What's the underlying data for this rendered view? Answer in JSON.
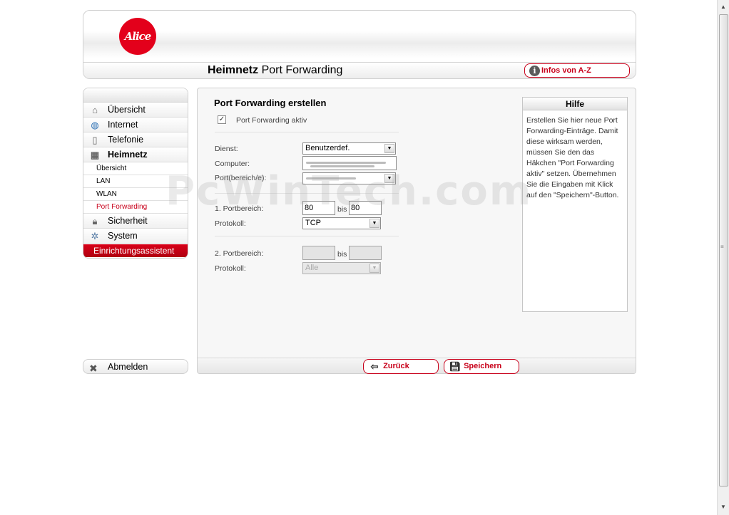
{
  "brand": {
    "logo_text": "Alice",
    "accent": "#e3001b"
  },
  "header": {
    "title_bold": "Heimnetz",
    "title_rest": " Port Forwarding",
    "infos_label": "Infos von A-Z"
  },
  "sidebar": {
    "items": [
      {
        "label": "Übersicht",
        "icon": "house-icon"
      },
      {
        "label": "Internet",
        "icon": "globe-icon"
      },
      {
        "label": "Telefonie",
        "icon": "phone-icon"
      },
      {
        "label": "Heimnetz",
        "icon": "network-icon"
      }
    ],
    "subitems": [
      {
        "label": "Übersicht"
      },
      {
        "label": "LAN"
      },
      {
        "label": "WLAN"
      },
      {
        "label": "Port Forwarding"
      }
    ],
    "items_after": [
      {
        "label": "Sicherheit",
        "icon": "lock-icon"
      },
      {
        "label": "System",
        "icon": "gears-icon"
      }
    ],
    "assistant_label": "Einrichtungsassistent",
    "logout_label": "Abmelden"
  },
  "form": {
    "section_title": "Port Forwarding erstellen",
    "active_checkbox": {
      "label": "Port Forwarding aktiv",
      "checked": true
    },
    "dienst": {
      "label": "Dienst:",
      "value": "Benutzerdef."
    },
    "computer": {
      "label": "Computer:"
    },
    "ports": {
      "label": "Port(bereich/e):"
    },
    "range1": {
      "label": "1. Portbereich:",
      "from": "80",
      "to_label": "bis",
      "to": "80"
    },
    "protocol1": {
      "label": "Protokoll:",
      "value": "TCP"
    },
    "range2": {
      "label": "2. Portbereich:",
      "from": "",
      "to_label": "bis",
      "to": ""
    },
    "protocol2": {
      "label": "Protokoll:",
      "value": "Alle"
    }
  },
  "help": {
    "title": "Hilfe",
    "text": "Erstellen Sie hier neue Port Forwarding-Einträge. Damit diese wirksam werden, müssen Sie den das Häkchen \"Port Forwarding aktiv\" setzen. Übernehmen Sie die Eingaben mit Klick auf den \"Speichern\"-Button."
  },
  "buttons": {
    "back_label": "Zurück",
    "save_label": "Speichern"
  },
  "watermark": "PcWinTech.com"
}
